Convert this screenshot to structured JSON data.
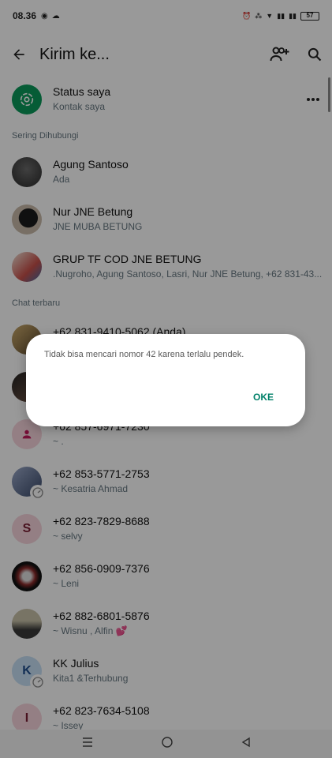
{
  "statusbar": {
    "time": "08.36",
    "battery": "57"
  },
  "appbar": {
    "title": "Kirim ke..."
  },
  "status_row": {
    "name": "Status saya",
    "sub": "Kontak saya"
  },
  "sections": {
    "frequent": "Sering Dihubungi",
    "recent": "Chat terbaru"
  },
  "frequent": [
    {
      "name": "Agung Santoso",
      "sub": "Ada"
    },
    {
      "name": "Nur JNE Betung",
      "sub": "JNE MUBA BETUNG"
    },
    {
      "name": "GRUP TF COD JNE BETUNG",
      "sub": ".Nugroho, Agung Santoso, Lasri, Nur JNE Betung, +62 831-43..."
    }
  ],
  "recent": [
    {
      "name": "+62 831-9410-5062 (Anda)",
      "sub": ""
    },
    {
      "name": "",
      "sub": ""
    },
    {
      "name": "+62 857-6971-7230",
      "sub": "~ ."
    },
    {
      "name": "+62 853-5771-2753",
      "sub": "~ Kesatria Ahmad"
    },
    {
      "name": "+62 823-7829-8688",
      "sub": "~ selvy",
      "initial": "S"
    },
    {
      "name": "+62 856-0909-7376",
      "sub": "~ Leni"
    },
    {
      "name": "+62 882-6801-5876",
      "sub": "~ Wisnu , Alfin 💕"
    },
    {
      "name": "KK Julius",
      "sub": "Kita1 &Terhubung",
      "initial": "K"
    },
    {
      "name": "+62 823-7634-5108",
      "sub": "~ Issey",
      "initial": "I"
    }
  ],
  "dialog": {
    "message": "Tidak bisa mencari nomor 42 karena terlalu pendek.",
    "ok": "OKE"
  },
  "colors": {
    "accent": "#008069",
    "status_green": "#0a9a5a"
  }
}
